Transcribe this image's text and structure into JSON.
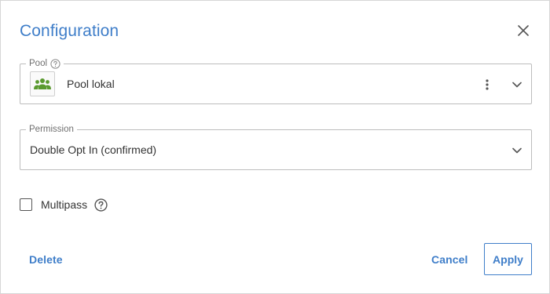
{
  "dialog": {
    "title": "Configuration",
    "close_icon": "close-icon"
  },
  "pool": {
    "legend": "Pool",
    "value": "Pool lokal",
    "avatar_icon": "people-group-icon",
    "avatar_color": "#5a9a2f"
  },
  "permission": {
    "legend": "Permission",
    "value": "Double Opt In (confirmed)"
  },
  "multipass": {
    "label": "Multipass",
    "checked": false
  },
  "actions": {
    "delete_label": "Delete",
    "cancel_label": "Cancel",
    "apply_label": "Apply"
  },
  "colors": {
    "accent": "#3f7ec9",
    "border": "#bdbdbd",
    "text": "#333333"
  }
}
